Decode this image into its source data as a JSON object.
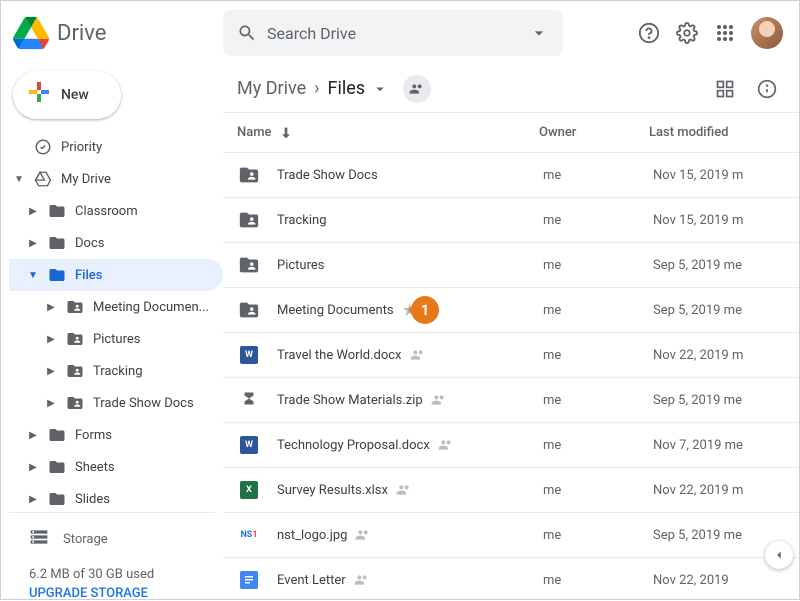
{
  "app": {
    "name": "Drive"
  },
  "search": {
    "placeholder": "Search Drive"
  },
  "newButton": {
    "label": "New"
  },
  "sidebar": {
    "priority": "Priority",
    "myDrive": "My Drive",
    "items": {
      "classroom": "Classroom",
      "docs": "Docs",
      "files": "Files",
      "meetingDocs": "Meeting Documen...",
      "pictures": "Pictures",
      "tracking": "Tracking",
      "tradeShow": "Trade Show Docs",
      "forms": "Forms",
      "sheets": "Sheets",
      "slides": "Slides"
    },
    "storage": {
      "label": "Storage",
      "used": "6.2 MB of 30 GB used",
      "upgrade": "UPGRADE STORAGE"
    }
  },
  "breadcrumb": {
    "root": "My Drive",
    "current": "Files"
  },
  "columns": {
    "name": "Name",
    "owner": "Owner",
    "modified": "Last modified"
  },
  "files": [
    {
      "name": "Trade Show Docs",
      "type": "folder-shared",
      "owner": "me",
      "modified": "Nov 15, 2019",
      "modBy": "m"
    },
    {
      "name": "Tracking",
      "type": "folder-shared",
      "owner": "me",
      "modified": "Nov 15, 2019",
      "modBy": "m"
    },
    {
      "name": "Pictures",
      "type": "folder-shared",
      "owner": "me",
      "modified": "Sep 5, 2019",
      "modBy": "me"
    },
    {
      "name": "Meeting Documents",
      "type": "folder-shared",
      "owner": "me",
      "modified": "Sep 5, 2019",
      "modBy": "me",
      "star": true,
      "callout": "1"
    },
    {
      "name": "Travel the World.docx",
      "type": "word",
      "owner": "me",
      "modified": "Nov 22, 2019",
      "modBy": "m",
      "shared": true
    },
    {
      "name": "Trade Show Materials.zip",
      "type": "zip",
      "owner": "me",
      "modified": "Sep 5, 2019",
      "modBy": "me",
      "shared": true
    },
    {
      "name": "Technology Proposal.docx",
      "type": "word",
      "owner": "me",
      "modified": "Nov 7, 2019",
      "modBy": "me",
      "shared": true
    },
    {
      "name": "Survey Results.xlsx",
      "type": "excel",
      "owner": "me",
      "modified": "Nov 22, 2019",
      "modBy": "m",
      "shared": true
    },
    {
      "name": "nst_logo.jpg",
      "type": "image",
      "owner": "me",
      "modified": "Sep 5, 2019",
      "modBy": "me",
      "shared": true
    },
    {
      "name": "Event Letter",
      "type": "gdoc",
      "owner": "me",
      "modified": "Nov 22, 2019",
      "modBy": "",
      "shared": true
    }
  ]
}
